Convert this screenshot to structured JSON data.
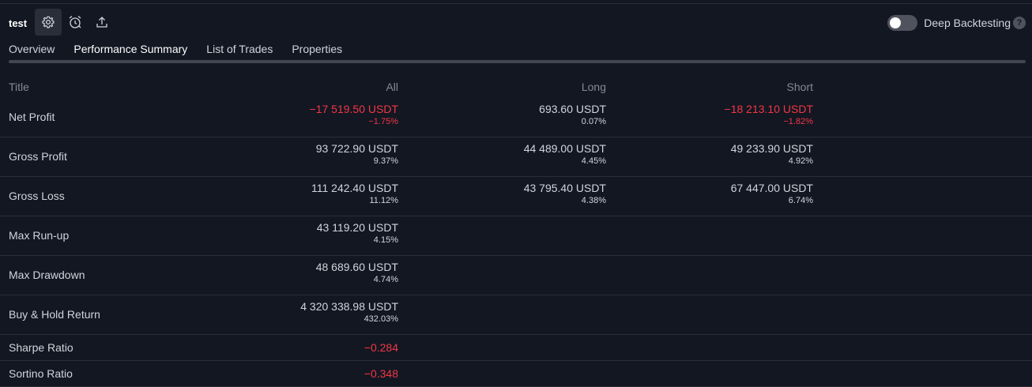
{
  "header": {
    "script_name": "test",
    "deep_backtesting_label": "Deep Backtesting",
    "help_glyph": "?",
    "deep_backtesting_enabled": false,
    "icons": [
      "settings-gear-icon",
      "alarm-clock-icon",
      "export-upload-icon",
      "help-icon"
    ]
  },
  "tabs": [
    {
      "label": "Overview",
      "active": false
    },
    {
      "label": "Performance Summary",
      "active": true
    },
    {
      "label": "List of Trades",
      "active": false
    },
    {
      "label": "Properties",
      "active": false
    }
  ],
  "table": {
    "columns": [
      "Title",
      "All",
      "Long",
      "Short"
    ],
    "rows": [
      {
        "title": "Net Profit",
        "all": {
          "value": "−17 519.50 USDT",
          "pct": "−1.75%",
          "negative": true
        },
        "long": {
          "value": "693.60 USDT",
          "pct": "0.07%",
          "negative": false
        },
        "short": {
          "value": "−18 213.10 USDT",
          "pct": "−1.82%",
          "negative": true
        }
      },
      {
        "title": "Gross Profit",
        "all": {
          "value": "93 722.90 USDT",
          "pct": "9.37%"
        },
        "long": {
          "value": "44 489.00 USDT",
          "pct": "4.45%"
        },
        "short": {
          "value": "49 233.90 USDT",
          "pct": "4.92%"
        }
      },
      {
        "title": "Gross Loss",
        "all": {
          "value": "111 242.40 USDT",
          "pct": "11.12%"
        },
        "long": {
          "value": "43 795.40 USDT",
          "pct": "4.38%"
        },
        "short": {
          "value": "67 447.00 USDT",
          "pct": "6.74%"
        }
      },
      {
        "title": "Max Run-up",
        "all": {
          "value": "43 119.20 USDT",
          "pct": "4.15%"
        }
      },
      {
        "title": "Max Drawdown",
        "all": {
          "value": "48 689.60 USDT",
          "pct": "4.74%"
        }
      },
      {
        "title": "Buy & Hold Return",
        "all": {
          "value": "4 320 338.98 USDT",
          "pct": "432.03%"
        }
      },
      {
        "title": "Sharpe Ratio",
        "all": {
          "value": "−0.284",
          "negative": true
        }
      },
      {
        "title": "Sortino Ratio",
        "all": {
          "value": "−0.348",
          "negative": true
        }
      }
    ]
  },
  "colors": {
    "background": "#131722",
    "negative": "#f23645",
    "text": "#d1d4dc",
    "muted": "#868993"
  }
}
